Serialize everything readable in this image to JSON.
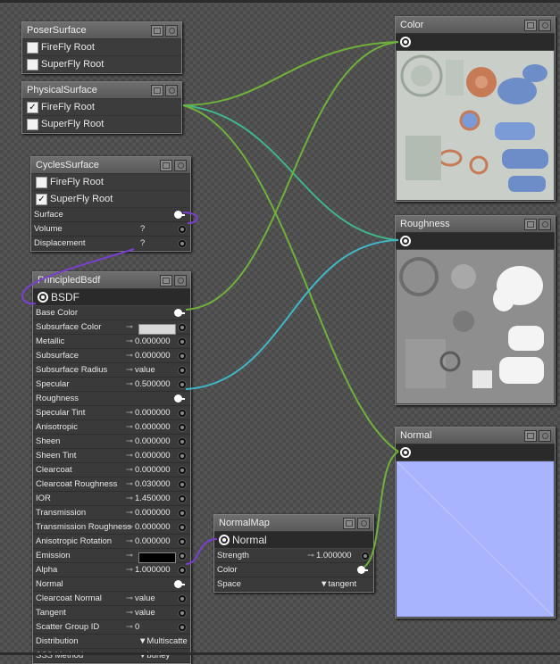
{
  "poser_surface": {
    "title": "PoserSurface",
    "rows": [
      {
        "label": "FireFly Root",
        "checked": false
      },
      {
        "label": "SuperFly Root",
        "checked": false
      }
    ]
  },
  "physical_surface": {
    "title": "PhysicalSurface",
    "rows": [
      {
        "label": "FireFly Root",
        "checked": true
      },
      {
        "label": "SuperFly Root",
        "checked": false
      }
    ]
  },
  "cycles_surface": {
    "title": "CyclesSurface",
    "rows": [
      {
        "label": "FireFly Root",
        "checked": false
      },
      {
        "label": "SuperFly Root",
        "checked": true
      }
    ],
    "inputs": [
      {
        "label": "Surface",
        "value": ""
      },
      {
        "label": "Volume",
        "value": "?"
      },
      {
        "label": "Displacement",
        "value": "?"
      }
    ]
  },
  "principled": {
    "title": "PrincipledBsdf",
    "output": "BSDF",
    "params": [
      {
        "label": "Base Color",
        "value": ""
      },
      {
        "label": "Subsurface Color",
        "value": ""
      },
      {
        "label": "Metallic",
        "value": "0.000000"
      },
      {
        "label": "Subsurface",
        "value": "0.000000"
      },
      {
        "label": "Subsurface Radius",
        "value": "value"
      },
      {
        "label": "Specular",
        "value": "0.500000"
      },
      {
        "label": "Roughness",
        "value": ""
      },
      {
        "label": "Specular Tint",
        "value": "0.000000"
      },
      {
        "label": "Anisotropic",
        "value": "0.000000"
      },
      {
        "label": "Sheen",
        "value": "0.000000"
      },
      {
        "label": "Sheen Tint",
        "value": "0.000000"
      },
      {
        "label": "Clearcoat",
        "value": "0.000000"
      },
      {
        "label": "Clearcoat Roughness",
        "value": "0.030000"
      },
      {
        "label": "IOR",
        "value": "1.450000"
      },
      {
        "label": "Transmission",
        "value": "0.000000"
      },
      {
        "label": "Transmission Roughness",
        "value": "0.000000"
      },
      {
        "label": "Anisotropic Rotation",
        "value": "0.000000"
      },
      {
        "label": "Emission",
        "value": ""
      },
      {
        "label": "Alpha",
        "value": "1.000000"
      },
      {
        "label": "Normal",
        "value": ""
      },
      {
        "label": "Clearcoat Normal",
        "value": "value"
      },
      {
        "label": "Tangent",
        "value": "value"
      },
      {
        "label": "Scatter Group ID",
        "value": "0"
      },
      {
        "label": "Distribution",
        "value": "Multiscatte"
      },
      {
        "label": "SSS Method",
        "value": "burley"
      }
    ],
    "subsurface_color": "#d9d9d9",
    "emission_color": "#000000"
  },
  "normal_map": {
    "title": "NormalMap",
    "output": "Normal",
    "params": [
      {
        "label": "Strength",
        "value": "1.000000"
      },
      {
        "label": "Color",
        "value": ""
      },
      {
        "label": "Space",
        "value": "tangent"
      }
    ]
  },
  "color_tex": {
    "title": "Color"
  },
  "roughness_tex": {
    "title": "Roughness"
  },
  "normal_tex": {
    "title": "Normal",
    "tint": "#a9b4ff"
  },
  "colors": {
    "wire_green": "#6fb23a",
    "wire_cyan": "#3fb7c8",
    "wire_purple": "#7a3fd0",
    "wire_teal": "#3fb78a"
  }
}
